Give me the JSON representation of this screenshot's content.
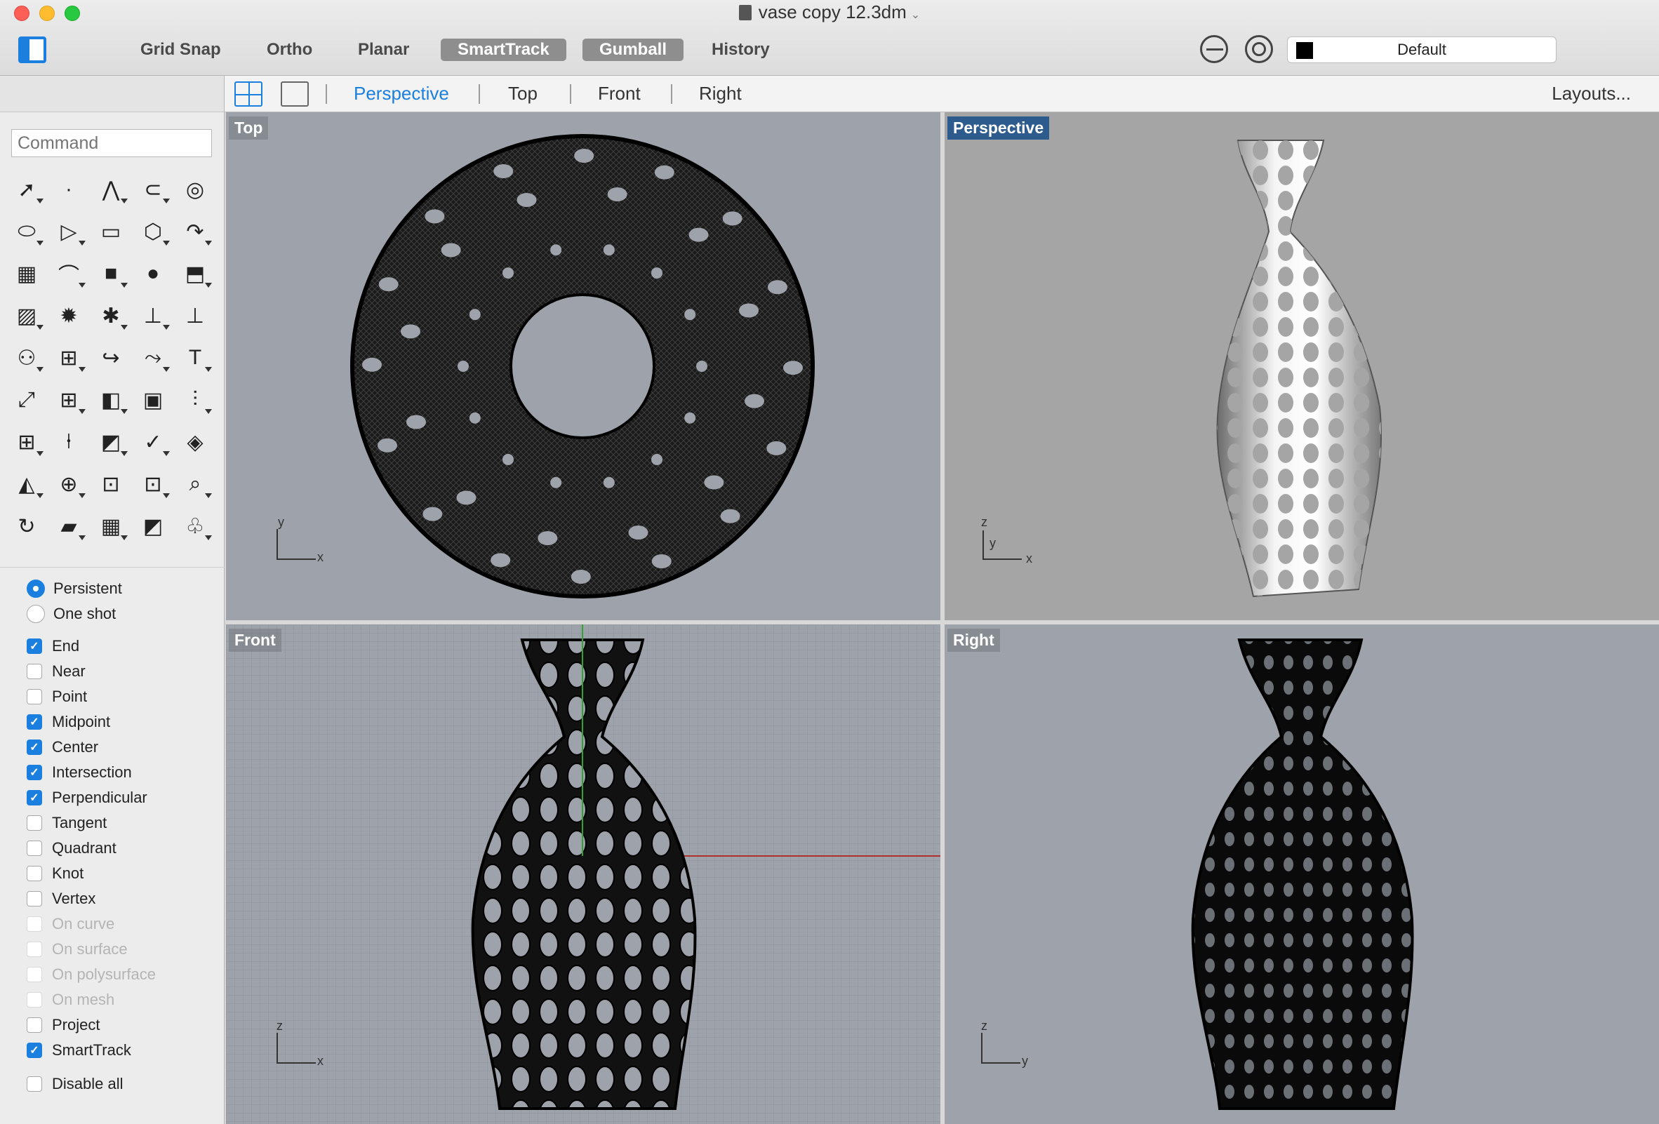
{
  "window": {
    "title": "vase copy 12.3dm"
  },
  "toolbar": {
    "modes": [
      {
        "label": "Grid Snap",
        "active": false
      },
      {
        "label": "Ortho",
        "active": false
      },
      {
        "label": "Planar",
        "active": false
      },
      {
        "label": "SmartTrack",
        "active": true
      },
      {
        "label": "Gumball",
        "active": true
      },
      {
        "label": "History",
        "active": false
      }
    ],
    "layer": "Default",
    "layer_color": "#000000"
  },
  "sidebar": {
    "command_placeholder": "Command",
    "tools": [
      "arrow-select",
      "point",
      "polyline",
      "curve",
      "circle",
      "ellipse",
      "arc",
      "rectangle",
      "polygon",
      "fillet",
      "surface-pts",
      "loft",
      "box",
      "sphere-union",
      "cylinder",
      "plane-surface",
      "explode",
      "solid-edit",
      "extract",
      "trim",
      "boolean",
      "group",
      "curve-tangent",
      "blend",
      "text",
      "scale",
      "array",
      "edit",
      "solid-tool",
      "render-wall",
      "grid-array",
      "align",
      "offset",
      "check",
      "shade",
      "paint",
      "zoom-in",
      "zoom-window",
      "zoom-extents",
      "zoom",
      "pan-rotate",
      "car",
      "mesh",
      "lights",
      "bulb"
    ],
    "object_snap_modes": [
      {
        "label": "Persistent",
        "type": "radio",
        "checked": true
      },
      {
        "label": "One shot",
        "type": "radio",
        "checked": false
      }
    ],
    "osnaps": [
      {
        "label": "End",
        "checked": true,
        "enabled": true
      },
      {
        "label": "Near",
        "checked": false,
        "enabled": true
      },
      {
        "label": "Point",
        "checked": false,
        "enabled": true
      },
      {
        "label": "Midpoint",
        "checked": true,
        "enabled": true
      },
      {
        "label": "Center",
        "checked": true,
        "enabled": true
      },
      {
        "label": "Intersection",
        "checked": true,
        "enabled": true
      },
      {
        "label": "Perpendicular",
        "checked": true,
        "enabled": true
      },
      {
        "label": "Tangent",
        "checked": false,
        "enabled": true
      },
      {
        "label": "Quadrant",
        "checked": false,
        "enabled": true
      },
      {
        "label": "Knot",
        "checked": false,
        "enabled": true
      },
      {
        "label": "Vertex",
        "checked": false,
        "enabled": true
      },
      {
        "label": "On curve",
        "checked": false,
        "enabled": false
      },
      {
        "label": "On surface",
        "checked": false,
        "enabled": false
      },
      {
        "label": "On polysurface",
        "checked": false,
        "enabled": false
      },
      {
        "label": "On mesh",
        "checked": false,
        "enabled": false
      },
      {
        "label": "Project",
        "checked": false,
        "enabled": true
      },
      {
        "label": "SmartTrack",
        "checked": true,
        "enabled": true
      }
    ],
    "disable_all": "Disable all"
  },
  "viewport_tabs": {
    "tabs": [
      "Perspective",
      "Top",
      "Front",
      "Right"
    ],
    "active": "Perspective",
    "layouts": "Layouts..."
  },
  "viewports": {
    "top": {
      "label": "Top",
      "axis_x": "x",
      "axis_y": "y"
    },
    "perspective": {
      "label": "Perspective",
      "axis_z": "z",
      "axis_y": "y",
      "axis_x": "x"
    },
    "front": {
      "label": "Front",
      "axis_z": "z",
      "axis_x": "x"
    },
    "right": {
      "label": "Right",
      "axis_z": "z",
      "axis_y": "y"
    }
  }
}
